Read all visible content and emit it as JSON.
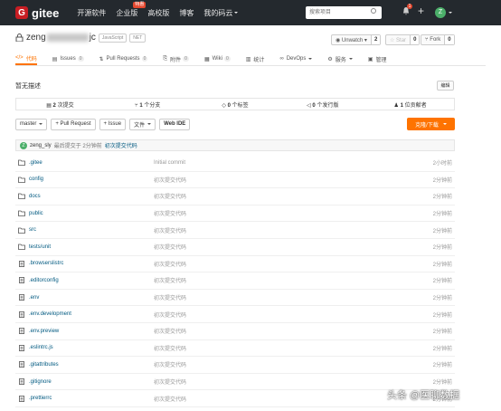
{
  "nav": {
    "logo": "G",
    "brand": "gitee",
    "links": [
      {
        "label": "开源软件"
      },
      {
        "label": "企业版",
        "badge": "特惠"
      },
      {
        "label": "高校版"
      },
      {
        "label": "博客"
      },
      {
        "label": "我的码云"
      }
    ],
    "search_placeholder": "搜索项目",
    "notification_count": "1",
    "plus": "+",
    "avatar_letter": "Z"
  },
  "repo": {
    "name_prefix": "zeng",
    "name_suffix": "jc",
    "tags": [
      "JavaScript",
      "NET"
    ],
    "watch_label": "Unwatch",
    "watch_count": "2",
    "star_label": "Star",
    "star_count": "0",
    "fork_label": "Fork",
    "fork_count": "0"
  },
  "tabs": [
    {
      "label": "代码",
      "icon": "</>",
      "count": ""
    },
    {
      "label": "Issues",
      "icon": "▤",
      "count": "0"
    },
    {
      "label": "Pull Requests",
      "icon": "⇅",
      "count": "0"
    },
    {
      "label": "附件",
      "icon": "⎘",
      "count": "0"
    },
    {
      "label": "Wiki",
      "icon": "▦",
      "count": "0"
    },
    {
      "label": "统计",
      "icon": "▥",
      "count": ""
    },
    {
      "label": "DevOps",
      "icon": "∞",
      "count": ""
    },
    {
      "label": "服务",
      "icon": "⚙",
      "count": ""
    },
    {
      "label": "管理",
      "icon": "▣",
      "count": ""
    }
  ],
  "description": "暂无描述",
  "edit_label": "编辑",
  "stats": [
    {
      "icon": "▤",
      "value": "2",
      "label": "次提交"
    },
    {
      "icon": "⑂",
      "value": "1",
      "label": "个分支"
    },
    {
      "icon": "◇",
      "value": "0",
      "label": "个标签"
    },
    {
      "icon": "◁",
      "value": "0",
      "label": "个发行版"
    },
    {
      "icon": "♟",
      "value": "1",
      "label": "位贡献者"
    }
  ],
  "toolbar": {
    "branch": "master",
    "pull_request": "+ Pull Request",
    "issue": "+ Issue",
    "file": "文件",
    "web_ide": "Web IDE",
    "clone": "克隆/下载"
  },
  "last_commit": {
    "avatar": "Z",
    "author": "zeng_sly",
    "meta": "最后提交于 2分钟前",
    "message": "初次提交代码"
  },
  "files": [
    {
      "type": "folder",
      "name": ".gitee",
      "commit": "Initial commit",
      "time": "2小时前"
    },
    {
      "type": "folder",
      "name": "config",
      "commit": "初次提交代码",
      "time": "2分钟前"
    },
    {
      "type": "folder",
      "name": "docs",
      "commit": "初次提交代码",
      "time": "2分钟前"
    },
    {
      "type": "folder",
      "name": "public",
      "commit": "初次提交代码",
      "time": "2分钟前"
    },
    {
      "type": "folder",
      "name": "src",
      "commit": "初次提交代码",
      "time": "2分钟前"
    },
    {
      "type": "folder",
      "name": "tests/unit",
      "commit": "初次提交代码",
      "time": "2分钟前"
    },
    {
      "type": "file",
      "name": ".browserslistrc",
      "commit": "初次提交代码",
      "time": "2分钟前"
    },
    {
      "type": "file",
      "name": ".editorconfig",
      "commit": "初次提交代码",
      "time": "2分钟前"
    },
    {
      "type": "file",
      "name": ".env",
      "commit": "初次提交代码",
      "time": "2分钟前"
    },
    {
      "type": "file",
      "name": ".env.development",
      "commit": "初次提交代码",
      "time": "2分钟前"
    },
    {
      "type": "file",
      "name": ".env.preview",
      "commit": "初次提交代码",
      "time": "2分钟前"
    },
    {
      "type": "file",
      "name": ".eslintrc.js",
      "commit": "初次提交代码",
      "time": "2分钟前"
    },
    {
      "type": "file",
      "name": ".gitattributes",
      "commit": "初次提交代码",
      "time": "2分钟前"
    },
    {
      "type": "file",
      "name": ".gitignore",
      "commit": "初次提交代码",
      "time": "2分钟前"
    },
    {
      "type": "file",
      "name": ".prettierrc",
      "commit": "初次提交代码",
      "time": "2分钟前"
    }
  ],
  "watermark": "头条 @医聊数据"
}
